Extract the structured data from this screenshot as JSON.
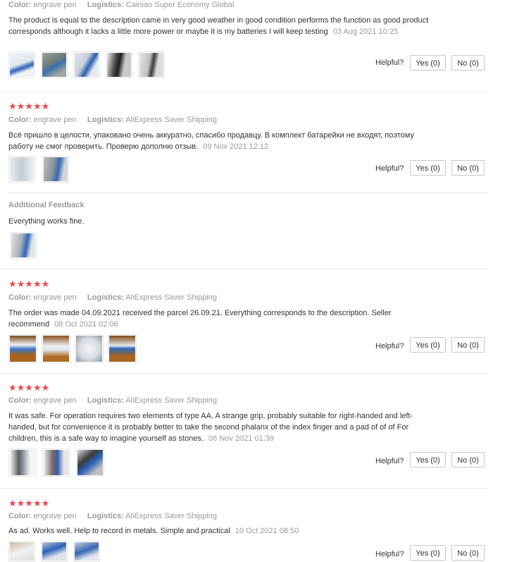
{
  "labels": {
    "color": "Color:",
    "logistics": "Logistics:",
    "helpful": "Helpful?",
    "yes": "Yes (0)",
    "no": "No (0)",
    "additional_feedback": "Additional Feedback"
  },
  "reviews": [
    {
      "color": "engrave pen",
      "logistics": "Cainiao Super Economy Global",
      "text": "The product is equal to the description came in very good weather in good condition performs the function as good product corresponds although it lacks a little more power or maybe it is my batteries I will keep testing",
      "date": "03 Aug 2021 10:25"
    },
    {
      "stars": "★★★★★",
      "color": "engrave pen",
      "logistics": "AliExpress Saver Shipping",
      "text": "Всё пришло в целости, упаковано очень аккуратно, спасибо продавцу. В комплект батарейки не входят, поэтому работу не смог проверить. Проверю дополню отзыв.",
      "date": "09 Nov 2021 12:12",
      "additional_text": "Everything works fine."
    },
    {
      "stars": "★★★★★",
      "color": "engrave pen",
      "logistics": "AliExpress Saver Shipping",
      "text": "The order was made 04.09.2021 received the parcel 26.09.21. Everything corresponds to the description. Seller recommend",
      "date": "08 Oct 2021 02:06"
    },
    {
      "stars": "★★★★★",
      "color": "engrave pen",
      "logistics": "AliExpress Saver Shipping",
      "text": "It was safe. For operation requires two elements of type AA. A strange grip, probably suitable for right-handed and left-handed, but for convenience it is probably better to take the second phalanx of the index finger and a pad of of of For children, this is a safe way to imagine yourself as stones.",
      "date": "06 Nov 2021 01:39"
    },
    {
      "stars": "★★★★★",
      "color": "engrave pen",
      "logistics": "AliExpress Saver Shipping",
      "text": "As ad. Works well. Help to record in metals. Simple and practical",
      "date": "10 Oct 2021 08:50"
    }
  ],
  "colors": {
    "star": "#e9494b",
    "muted": "#999999",
    "text": "#333333",
    "border": "#c8c8c8"
  }
}
